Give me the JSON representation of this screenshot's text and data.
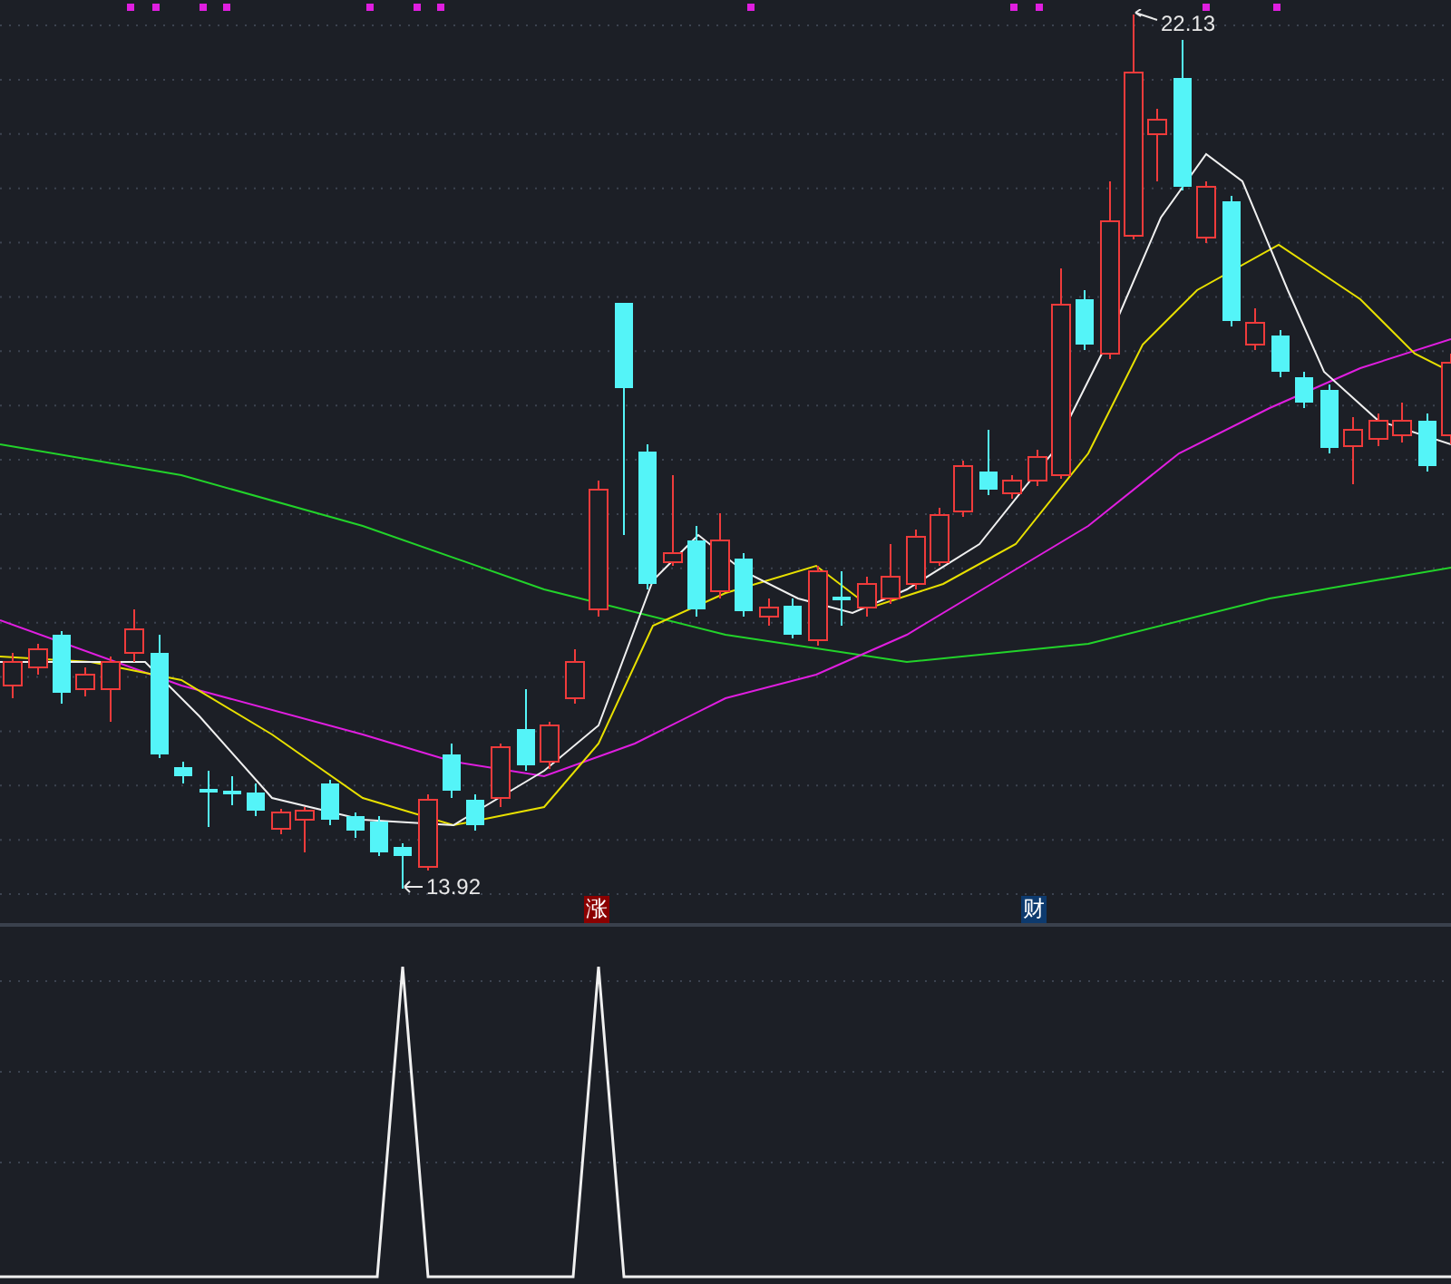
{
  "price_chart": {
    "high_label": "22.13",
    "low_label": "13.92"
  },
  "markers": [
    {
      "text": "涨",
      "color": "#8b0000"
    },
    {
      "text": "财",
      "color": "#0d3a6e"
    }
  ]
}
